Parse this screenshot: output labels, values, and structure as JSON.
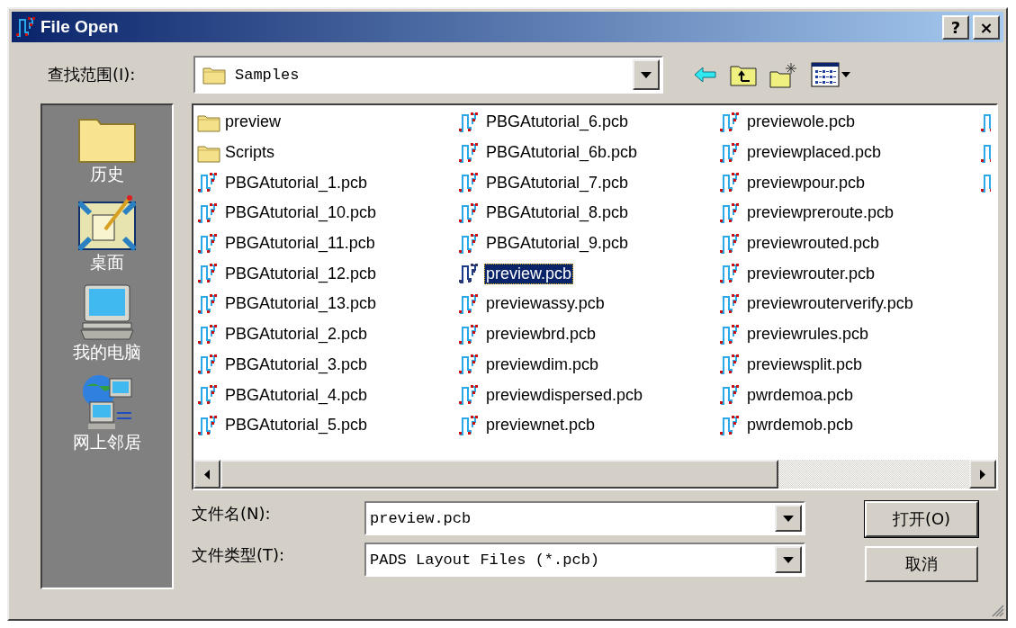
{
  "window": {
    "title": "File Open",
    "buttons": [
      "?",
      "×"
    ]
  },
  "look_in": {
    "label": "查找范围(I):",
    "value": "Samples"
  },
  "places": [
    {
      "kind": "history",
      "label": "历史"
    },
    {
      "kind": "desktop",
      "label": "桌面"
    },
    {
      "kind": "computer",
      "label": "我的电脑"
    },
    {
      "kind": "network",
      "label": "网上邻居"
    }
  ],
  "files": [
    {
      "kind": "folder",
      "name": "preview",
      "selected": false
    },
    {
      "kind": "folder",
      "name": "Scripts",
      "selected": false
    },
    {
      "kind": "pcb",
      "name": "PBGAtutorial_1.pcb",
      "selected": false
    },
    {
      "kind": "pcb",
      "name": "PBGAtutorial_10.pcb",
      "selected": false
    },
    {
      "kind": "pcb",
      "name": "PBGAtutorial_11.pcb",
      "selected": false
    },
    {
      "kind": "pcb",
      "name": "PBGAtutorial_12.pcb",
      "selected": false
    },
    {
      "kind": "pcb",
      "name": "PBGAtutorial_13.pcb",
      "selected": false
    },
    {
      "kind": "pcb",
      "name": "PBGAtutorial_2.pcb",
      "selected": false
    },
    {
      "kind": "pcb",
      "name": "PBGAtutorial_3.pcb",
      "selected": false
    },
    {
      "kind": "pcb",
      "name": "PBGAtutorial_4.pcb",
      "selected": false
    },
    {
      "kind": "pcb",
      "name": "PBGAtutorial_5.pcb",
      "selected": false
    },
    {
      "kind": "pcb",
      "name": "PBGAtutorial_6.pcb",
      "selected": false
    },
    {
      "kind": "pcb",
      "name": "PBGAtutorial_6b.pcb",
      "selected": false
    },
    {
      "kind": "pcb",
      "name": "PBGAtutorial_7.pcb",
      "selected": false
    },
    {
      "kind": "pcb",
      "name": "PBGAtutorial_8.pcb",
      "selected": false
    },
    {
      "kind": "pcb",
      "name": "PBGAtutorial_9.pcb",
      "selected": false
    },
    {
      "kind": "pcb",
      "name": "preview.pcb",
      "selected": true
    },
    {
      "kind": "pcb",
      "name": "previewassy.pcb",
      "selected": false
    },
    {
      "kind": "pcb",
      "name": "previewbrd.pcb",
      "selected": false
    },
    {
      "kind": "pcb",
      "name": "previewdim.pcb",
      "selected": false
    },
    {
      "kind": "pcb",
      "name": "previewdispersed.pcb",
      "selected": false
    },
    {
      "kind": "pcb",
      "name": "previewnet.pcb",
      "selected": false
    },
    {
      "kind": "pcb",
      "name": "previewole.pcb",
      "selected": false
    },
    {
      "kind": "pcb",
      "name": "previewplaced.pcb",
      "selected": false
    },
    {
      "kind": "pcb",
      "name": "previewpour.pcb",
      "selected": false
    },
    {
      "kind": "pcb",
      "name": "previewpreroute.pcb",
      "selected": false
    },
    {
      "kind": "pcb",
      "name": "previewrouted.pcb",
      "selected": false
    },
    {
      "kind": "pcb",
      "name": "previewrouter.pcb",
      "selected": false
    },
    {
      "kind": "pcb",
      "name": "previewrouterverify.pcb",
      "selected": false
    },
    {
      "kind": "pcb",
      "name": "previewrules.pcb",
      "selected": false
    },
    {
      "kind": "pcb",
      "name": "previewsplit.pcb",
      "selected": false
    },
    {
      "kind": "pcb",
      "name": "pwrdemoa.pcb",
      "selected": false
    },
    {
      "kind": "pcb",
      "name": "pwrdemob.pcb",
      "selected": false
    }
  ],
  "cut_off_column": [
    {
      "kind": "pcb"
    },
    {
      "kind": "pcb"
    },
    {
      "kind": "pcb"
    }
  ],
  "file_name": {
    "label": "文件名(N):",
    "value": "preview.pcb"
  },
  "file_type": {
    "label": "文件类型(T):",
    "value": "PADS Layout Files (*.pcb)"
  },
  "buttons": [
    "打开(O)",
    "取消"
  ]
}
